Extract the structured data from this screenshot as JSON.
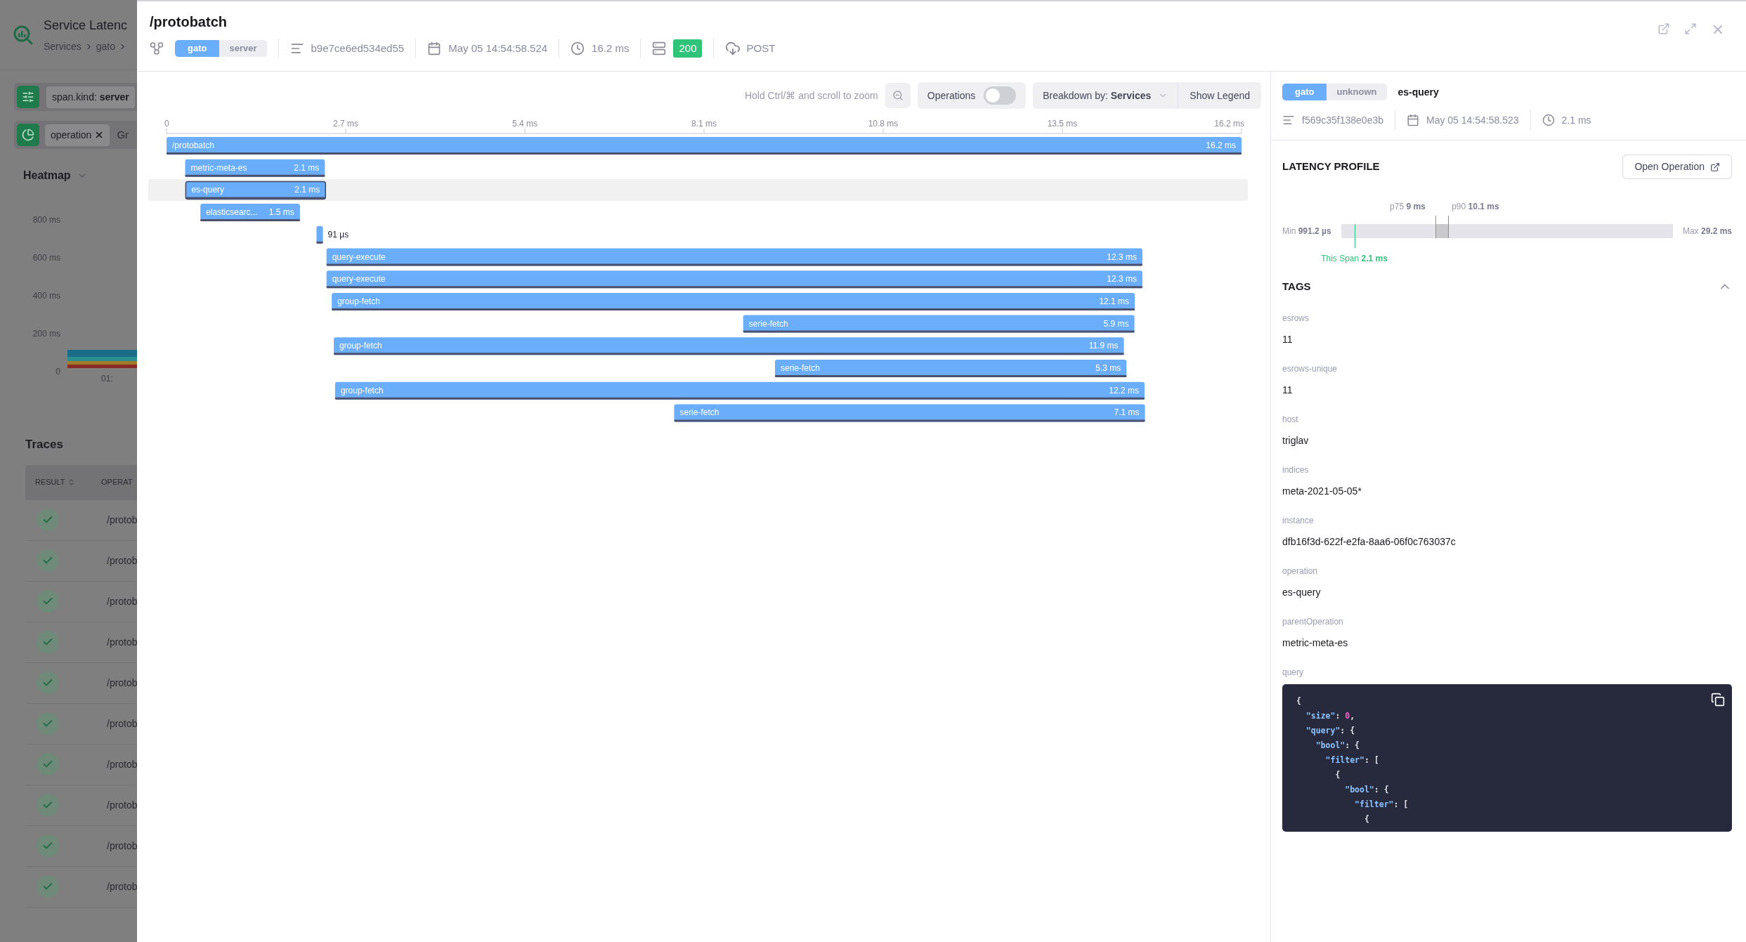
{
  "background_page": {
    "title": "Service Latenc",
    "breadcrumbs": [
      "Services",
      "gato"
    ],
    "filters": [
      {
        "key": "span.kind:",
        "value": "server"
      }
    ],
    "group_chip": "operation",
    "group_placeholder": "Gr",
    "heatmap": {
      "title": "Heatmap",
      "y_labels": [
        "800 ms",
        "600 ms",
        "400 ms",
        "200 ms",
        "0"
      ],
      "x_label": "01:"
    },
    "traces": {
      "title": "Traces",
      "columns": [
        "RESULT",
        "OPERAT"
      ],
      "rows": [
        {
          "operation": "/protob"
        },
        {
          "operation": "/protob"
        },
        {
          "operation": "/protob"
        },
        {
          "operation": "/protob"
        },
        {
          "operation": "/protob"
        },
        {
          "operation": "/protob"
        },
        {
          "operation": "/protob"
        },
        {
          "operation": "/protob"
        },
        {
          "operation": "/protob"
        },
        {
          "operation": "/protob"
        }
      ]
    }
  },
  "drawer": {
    "title": "/protobatch",
    "services": [
      {
        "label": "gato",
        "selected": true
      },
      {
        "label": "server",
        "selected": false
      }
    ],
    "trace_id": "b9e7ce6ed534ed55",
    "date": "May 05 14:54:58.524",
    "duration": "16.2 ms",
    "status": "200",
    "method": "POST"
  },
  "timeline": {
    "hint": "Hold Ctrl/⌘ and scroll to zoom",
    "operations_toggle": {
      "label": "Operations",
      "on": false
    },
    "breakdown": {
      "label": "Breakdown by:",
      "value": "Services"
    },
    "legend_button": "Show Legend",
    "ticks": [
      "0",
      "2.7 ms",
      "5.4 ms",
      "8.1 ms",
      "10.8 ms",
      "13.5 ms",
      "16.2 ms"
    ],
    "spans": [
      {
        "name": "/protobatch",
        "duration": "16.2 ms",
        "selected": false
      },
      {
        "name": "metric-meta-es",
        "duration": "2.1 ms",
        "selected": false
      },
      {
        "name": "es-query",
        "duration": "2.1 ms",
        "selected": true
      },
      {
        "name": "elasticsearc...",
        "duration": "1.5 ms",
        "selected": false
      },
      {
        "duration": "91 µs",
        "selected": false
      },
      {
        "name": "query-execute",
        "duration": "12.3 ms",
        "selected": false
      },
      {
        "name": "query-execute",
        "duration": "12.3 ms",
        "selected": false
      },
      {
        "name": "group-fetch",
        "duration": "12.1 ms",
        "selected": false
      },
      {
        "name": "serie-fetch",
        "duration": "5.9 ms",
        "selected": false
      },
      {
        "name": "group-fetch",
        "duration": "11.9 ms",
        "selected": false
      },
      {
        "name": "serie-fetch",
        "duration": "5.3 ms",
        "selected": false
      },
      {
        "name": "group-fetch",
        "duration": "12.2 ms",
        "selected": false
      },
      {
        "name": "serie-fetch",
        "duration": "7.1 ms",
        "selected": false
      }
    ]
  },
  "span_detail": {
    "services": [
      {
        "label": "gato",
        "selected": true
      },
      {
        "label": "unknown",
        "selected": false
      }
    ],
    "operation": "es-query",
    "span_id": "f569c35f138e0e3b",
    "date": "May 05 14:54:58.523",
    "duration": "2.1 ms",
    "latency_profile": {
      "title": "LATENCY PROFILE",
      "open_button": "Open Operation",
      "min": {
        "label": "Min",
        "value": "991.2 µs"
      },
      "max": {
        "label": "Max",
        "value": "29.2 ms"
      },
      "p75": {
        "label": "p75",
        "value": "9 ms",
        "level": 0.284
      },
      "p90": {
        "label": "p90",
        "value": "10.1 ms",
        "level": 0.323
      },
      "this_span": {
        "label": "This Span",
        "value": "2.1 ms",
        "level": 0.04
      }
    },
    "tags": {
      "title": "TAGS",
      "expanded": true,
      "items": [
        {
          "key": "esrows",
          "value": "11"
        },
        {
          "key": "esrows-unique",
          "value": "11"
        },
        {
          "key": "host",
          "value": "triglav"
        },
        {
          "key": "indices",
          "value": "meta-2021-05-05*"
        },
        {
          "key": "instance",
          "value": "dfb16f3d-622f-e2fa-8aa6-06f0c763037c"
        },
        {
          "key": "operation",
          "value": "es-query"
        },
        {
          "key": "parentOperation",
          "value": "metric-meta-es"
        }
      ],
      "query": {
        "key": "query",
        "lines": [
          "{",
          "  \"size\": 0,",
          "  \"query\": {",
          "    \"bool\": {",
          "      \"filter\": [",
          "        {",
          "          \"bool\": {",
          "            \"filter\": [",
          "              {"
        ]
      }
    }
  }
}
